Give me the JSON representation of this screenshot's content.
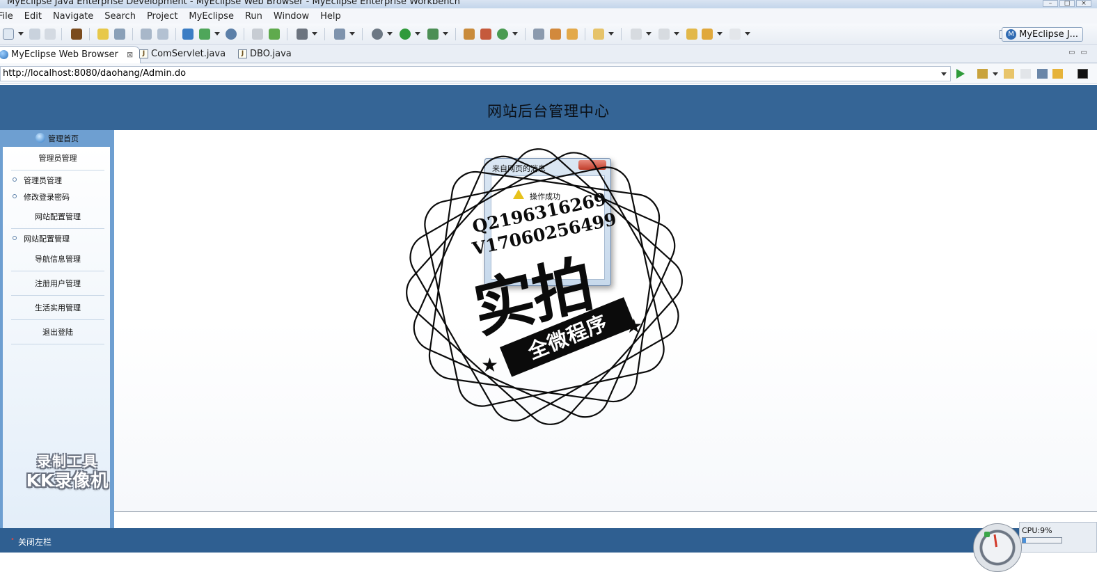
{
  "window": {
    "title": "MyEclipse Java Enterprise Development - MyEclipse Web Browser - MyEclipse Enterprise Workbench"
  },
  "menu": [
    "File",
    "Edit",
    "Navigate",
    "Search",
    "Project",
    "MyEclipse",
    "Run",
    "Window",
    "Help"
  ],
  "perspective": {
    "label": "MyEclipse J..."
  },
  "editor_tabs": [
    {
      "label": "MyEclipse Web Browser",
      "active": true,
      "icon": "globe-icon"
    },
    {
      "label": "ComServlet.java",
      "active": false,
      "icon": "java-file-icon"
    },
    {
      "label": "DBO.java",
      "active": false,
      "icon": "java-file-icon"
    }
  ],
  "browser": {
    "url": "http://localhost:8080/daohang/Admin.do"
  },
  "webpage": {
    "header_title": "网站后台管理中心",
    "sidebar": {
      "home_label": "管理首页",
      "sections": [
        {
          "title": "管理员管理",
          "items": [
            "管理员管理",
            "修改登录密码"
          ]
        },
        {
          "title": "网站配置管理",
          "items": [
            "网站配置管理"
          ]
        },
        {
          "title": "导航信息管理",
          "items": []
        },
        {
          "title": "注册用户管理",
          "items": []
        },
        {
          "title": "生活实用管理",
          "items": []
        },
        {
          "title": "退出登陆",
          "items": []
        }
      ]
    },
    "footer_left": "关闭左栏"
  },
  "dialog": {
    "title": "来自网页的消息",
    "message": "操作成功"
  },
  "watermark": {
    "qq": "Q2196316269",
    "wechat": "V17060256499",
    "big": "实拍",
    "ribbon": "全微程序",
    "recorder_line1": "录制工具",
    "recorder_line2": "KK录像机"
  },
  "system": {
    "cpu_label": "CPU:9%",
    "cpu_percent": 9
  },
  "colors": {
    "header_bg": "#356596",
    "sidebar_bg": "#6e9fd1",
    "footer_bg": "#2f5f91"
  }
}
